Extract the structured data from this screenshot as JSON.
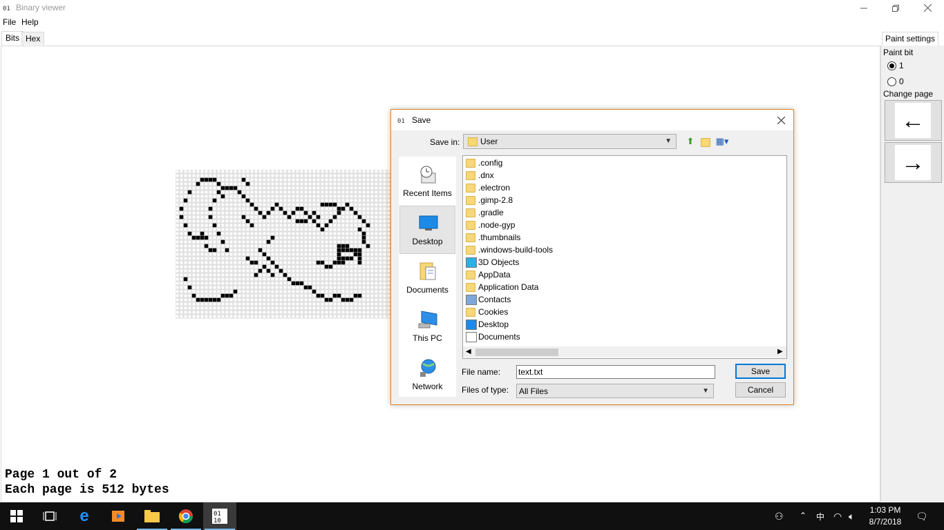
{
  "window": {
    "title": "Binary viewer"
  },
  "menu": {
    "file": "File",
    "help": "Help"
  },
  "tabs": {
    "bits": "Bits",
    "hex": "Hex"
  },
  "status": {
    "page_line": "Page 1 out of 2",
    "size_line": "Each page is 512 bytes"
  },
  "paint_settings": {
    "tab_label": "Paint settings",
    "paint_bit_label": "Paint bit",
    "options": [
      "1",
      "0"
    ],
    "selected": "1",
    "change_page_label": "Change page",
    "prev_glyph": "←",
    "next_glyph": "→"
  },
  "dialog": {
    "title": "Save",
    "save_in_label": "Save in:",
    "save_in_value": "User",
    "places": [
      "Recent Items",
      "Desktop",
      "Documents",
      "This PC",
      "Network"
    ],
    "selected_place": "Desktop",
    "files": [
      {
        "name": ".config",
        "icon": "folder-icon"
      },
      {
        "name": ".dnx",
        "icon": "folder-icon"
      },
      {
        "name": ".electron",
        "icon": "folder-icon"
      },
      {
        "name": ".gimp-2.8",
        "icon": "folder-icon"
      },
      {
        "name": ".gradle",
        "icon": "folder-icon"
      },
      {
        "name": ".node-gyp",
        "icon": "folder-icon"
      },
      {
        "name": ".thumbnails",
        "icon": "folder-icon"
      },
      {
        "name": ".windows-build-tools",
        "icon": "folder-icon"
      },
      {
        "name": "3D Objects",
        "icon": "3d-objects-icon"
      },
      {
        "name": "AppData",
        "icon": "folder-icon"
      },
      {
        "name": "Application Data",
        "icon": "shortcut-folder-icon"
      },
      {
        "name": "Contacts",
        "icon": "contacts-icon"
      },
      {
        "name": "Cookies",
        "icon": "folder-icon"
      },
      {
        "name": "Desktop",
        "icon": "desktop-icon"
      },
      {
        "name": "Documents",
        "icon": "documents-icon"
      }
    ],
    "file_name_label": "File name:",
    "file_name_value": "text.txt",
    "files_of_type_label": "Files of type:",
    "files_of_type_value": "All Files",
    "save_button": "Save",
    "cancel_button": "Cancel"
  },
  "taskbar": {
    "time": "1:03 PM",
    "date": "8/7/2018",
    "ime": "中"
  },
  "colors": {
    "accent": "#0078d7",
    "dialog_border": "#e67e22",
    "bit_on": "#000000",
    "bit_off": "#c8c8c8"
  }
}
